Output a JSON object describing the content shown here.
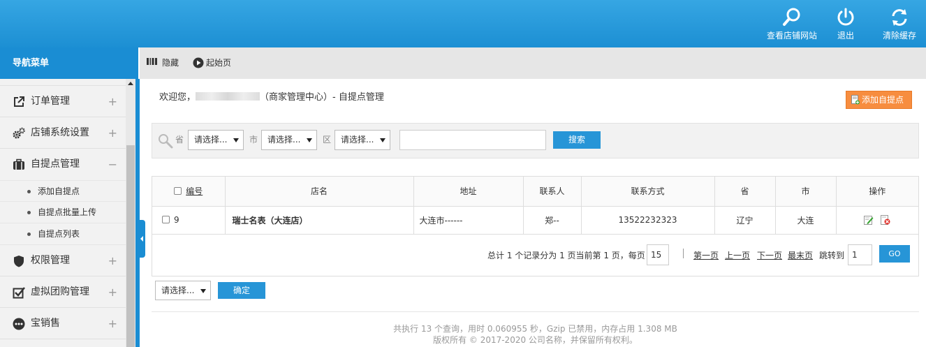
{
  "header": {
    "actions": [
      {
        "label": "查看店铺网站",
        "icon": "search-icon"
      },
      {
        "label": "退出",
        "icon": "power-icon"
      },
      {
        "label": "清除缓存",
        "icon": "refresh-icon"
      }
    ]
  },
  "sidebar": {
    "title": "导航菜单",
    "items": [
      {
        "label": "订单管理",
        "icon": "external-link-icon",
        "toggle": "+"
      },
      {
        "label": "店铺系统设置",
        "icon": "gears-icon",
        "toggle": "+"
      },
      {
        "label": "自提点管理",
        "icon": "briefcase-icon",
        "toggle": "−"
      },
      {
        "label": "权限管理",
        "icon": "shield-icon",
        "toggle": "+"
      },
      {
        "label": "虚拟团购管理",
        "icon": "checkbox-icon",
        "toggle": "+"
      },
      {
        "label": "宝销售",
        "icon": "more-icon",
        "toggle": "+"
      }
    ],
    "subitems": [
      "添加自提点",
      "自提点批量上传",
      "自提点列表"
    ]
  },
  "toolbar": {
    "hide_label": "隐藏",
    "home_label": "起始页"
  },
  "welcome": {
    "prefix": "欢迎您，",
    "suffix": "（商家管理中心）- 自提点管理"
  },
  "add_button": "添加自提点",
  "search": {
    "province_label": "省",
    "province_value": "请选择...",
    "city_label": "市",
    "city_value": "请选择...",
    "district_label": "区",
    "district_value": "请选择...",
    "keyword_value": "",
    "button": "搜索"
  },
  "table": {
    "headers": [
      "编号",
      "店名",
      "地址",
      "联系人",
      "联系方式",
      "省",
      "市",
      "操作"
    ],
    "rows": [
      {
        "id": "9",
        "name": "瑞士名表（大连店）",
        "address": "大连市------",
        "contact": "郑--",
        "phone": "13522232323",
        "province": "辽宁",
        "city": "大连"
      }
    ]
  },
  "pager": {
    "summary": "总计 1 个记录分为 1 页当前第 1 页，每页",
    "page_size": "15",
    "first": "第一页",
    "prev": "上一页",
    "next": "下一页",
    "last": "最末页",
    "jump_label": "跳转到",
    "jump_value": "1",
    "go": "GO"
  },
  "batch": {
    "select_value": "请选择...",
    "confirm": "确定"
  },
  "footer": {
    "line1": "共执行 13 个查询，用时 0.060955 秒，Gzip 已禁用，内存占用 1.308 MB",
    "line2": "版权所有 © 2017-2020 公司名称，并保留所有权利。"
  },
  "colors": {
    "brand_blue": "#1a8dd3",
    "accent_orange": "#f78d3f"
  }
}
